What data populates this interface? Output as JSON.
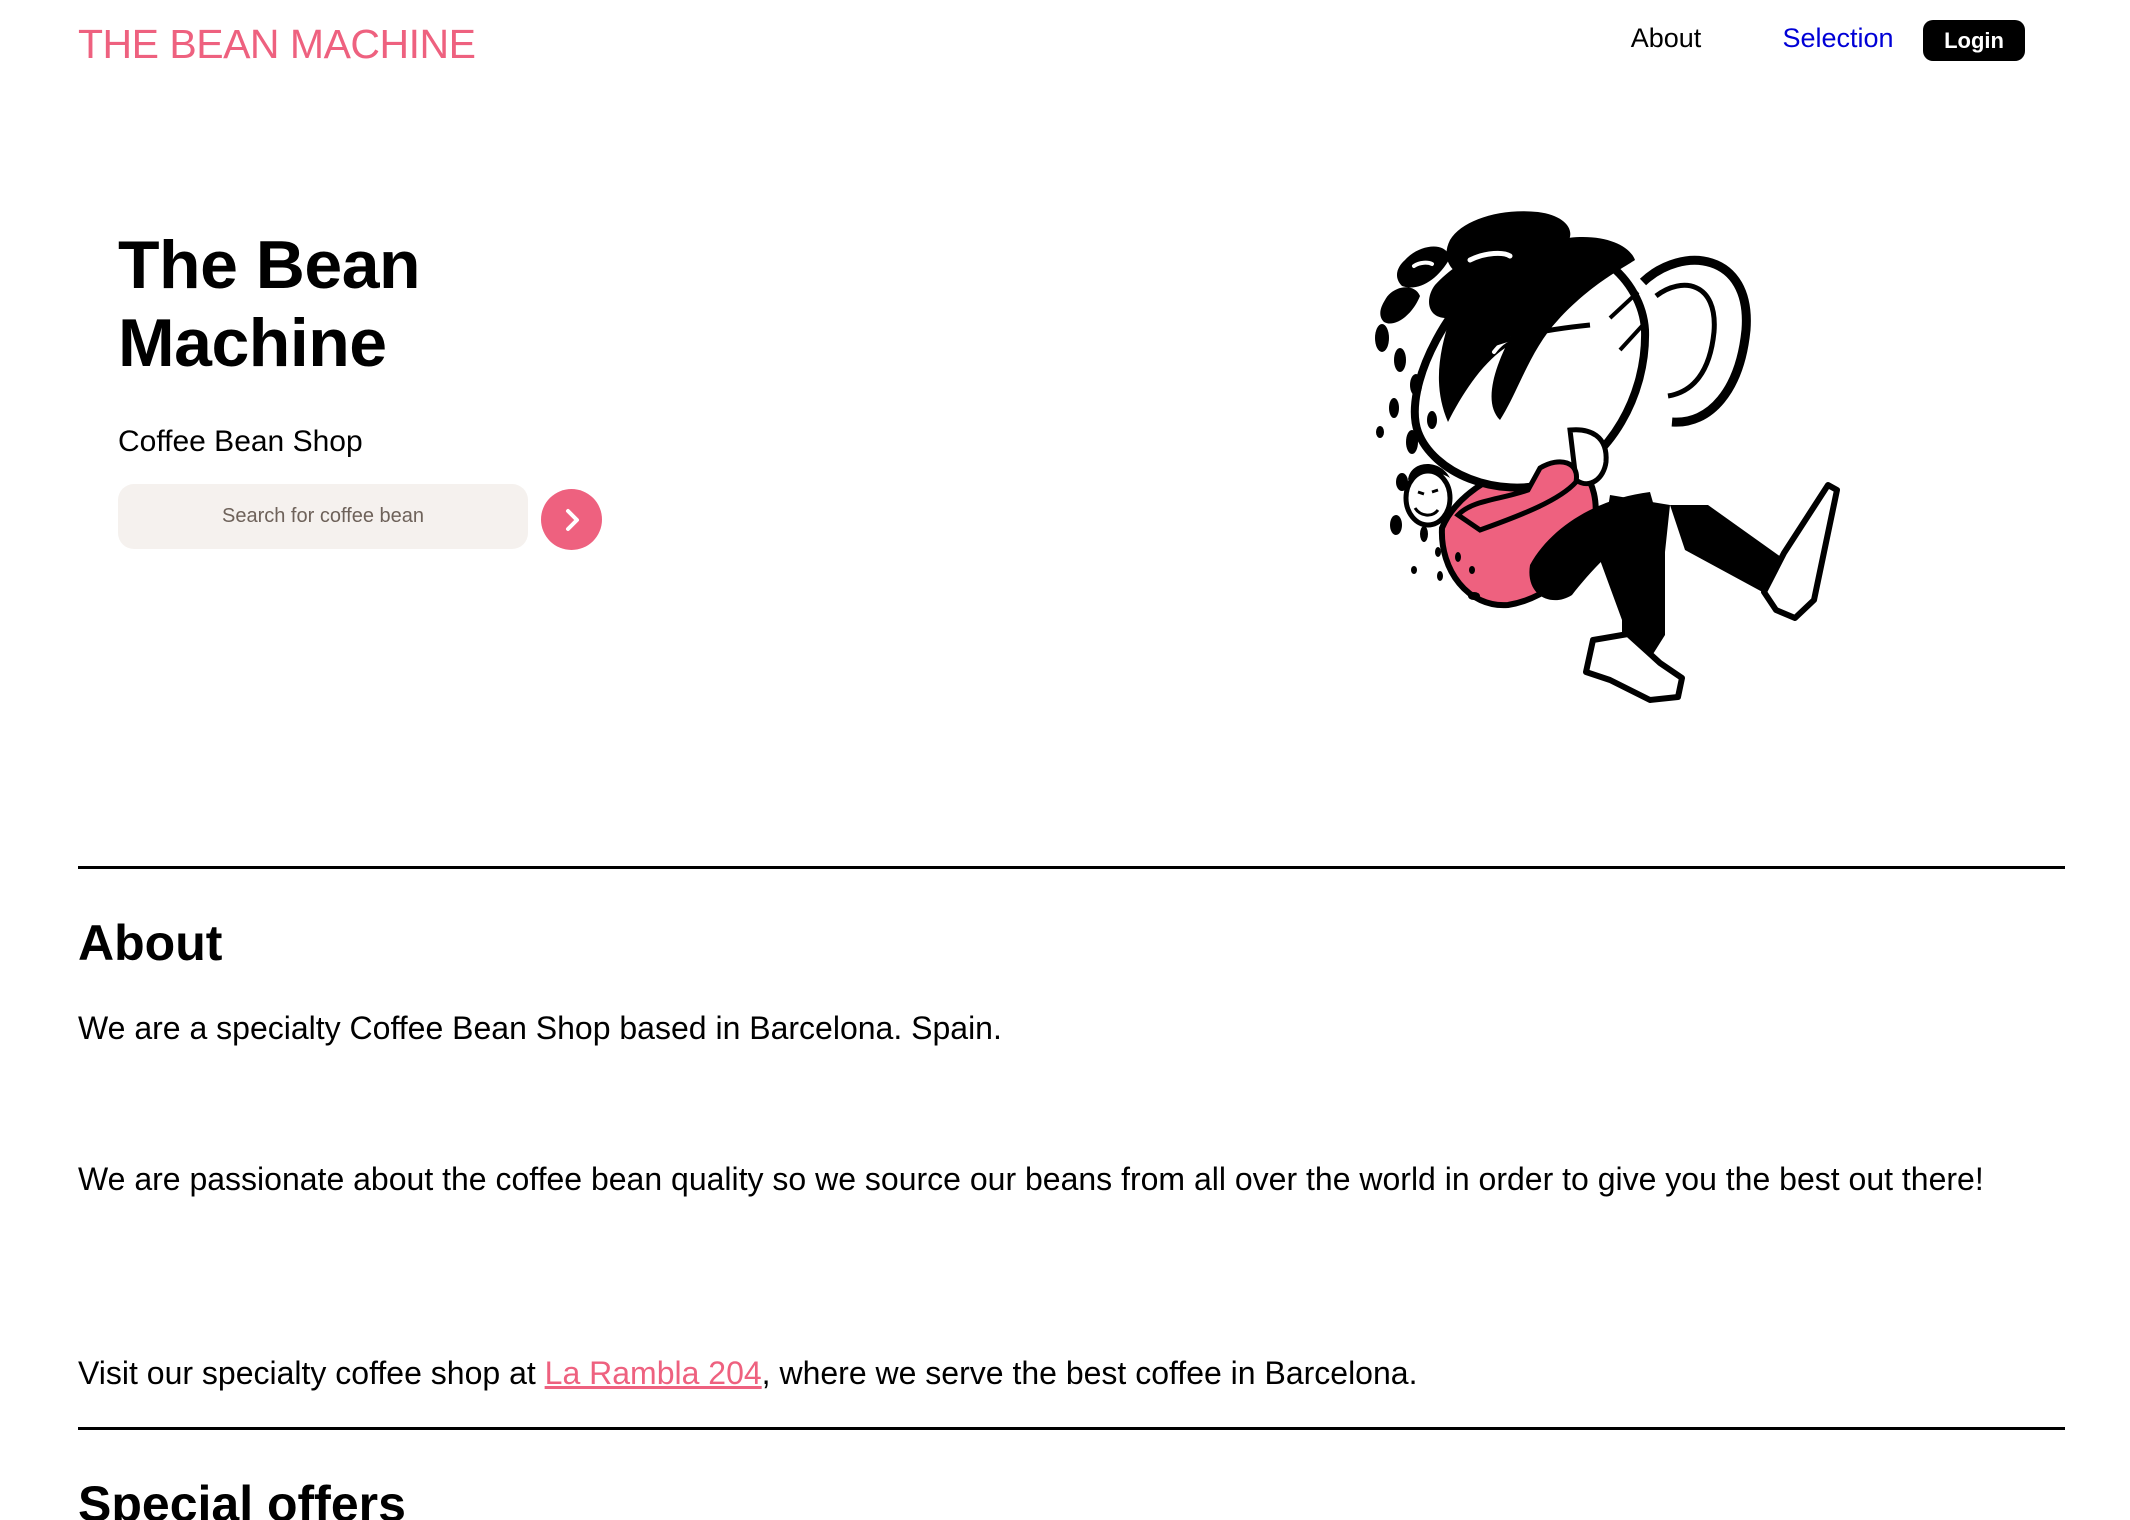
{
  "header": {
    "brand": "THE BEAN MACHINE",
    "nav": {
      "about": "About",
      "selection": "Selection"
    },
    "login_label": "Login"
  },
  "hero": {
    "title_line1": "The Bean",
    "title_line2": "Machine",
    "subtitle": "Coffee Bean Shop",
    "search": {
      "placeholder": "Search for coffee bean",
      "value": ""
    },
    "search_button_icon": "chevron-right-icon",
    "illustration": "person-jumping-out-of-coffee-cup"
  },
  "about": {
    "title": "About",
    "p1": "We are a specialty Coffee Bean Shop based in Barcelona. Spain.",
    "p2": "We are passionate about the coffee bean quality so we source our beans from all over the world in order to give you the best out there!",
    "p3_before": "Visit our specialty coffee shop at ",
    "p3_link": "La Rambla 204",
    "p3_after": ", where we serve the best coffee in Barcelona."
  },
  "offers": {
    "title": "Special offers"
  },
  "colors": {
    "accent": "#ee617f",
    "nav_link": "#0000d6",
    "search_bg": "#f5f1ee",
    "button_dark": "#000000"
  }
}
